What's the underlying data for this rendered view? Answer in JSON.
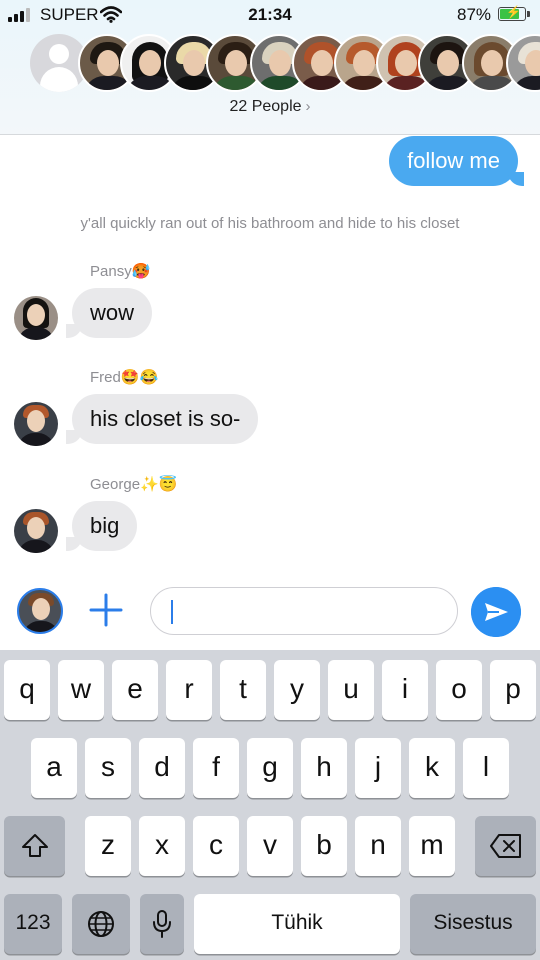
{
  "status_bar": {
    "carrier": "SUPER",
    "time": "21:34",
    "battery": "87%",
    "battery_level": 0.87
  },
  "header": {
    "people_label": "22 People",
    "avatar_count_visible": 12
  },
  "messages": {
    "outgoing": "follow me",
    "notice": "y'all quickly ran out of his bathroom and hide to his closet",
    "incoming": [
      {
        "sender": "Pansy",
        "emoji": "🥵",
        "text": "wow"
      },
      {
        "sender": "Fred",
        "emoji": "🤩😂",
        "text": "his closet is so-"
      },
      {
        "sender": "George",
        "emoji": "✨😇",
        "text": "big"
      }
    ]
  },
  "input_bar": {
    "placeholder": "",
    "value": ""
  },
  "keyboard": {
    "row1": [
      "q",
      "w",
      "e",
      "r",
      "t",
      "y",
      "u",
      "i",
      "o",
      "p"
    ],
    "row2": [
      "a",
      "s",
      "d",
      "f",
      "g",
      "h",
      "j",
      "k",
      "l"
    ],
    "row3": [
      "z",
      "x",
      "c",
      "v",
      "b",
      "n",
      "m"
    ],
    "numbers_key": "123",
    "space_key": "Tühik",
    "return_key": "Sisestus"
  },
  "colors": {
    "accent": "#2b8ff2",
    "outgoing_bubble": "#4aa9f0",
    "incoming_bubble": "#e9e9eb",
    "keyboard_bg": "#d2d5db"
  },
  "icons": [
    "signal-icon",
    "wifi-icon",
    "battery-icon",
    "chevron-right-icon",
    "plus-icon",
    "send-icon",
    "shift-icon",
    "backspace-icon",
    "globe-icon",
    "microphone-icon"
  ]
}
